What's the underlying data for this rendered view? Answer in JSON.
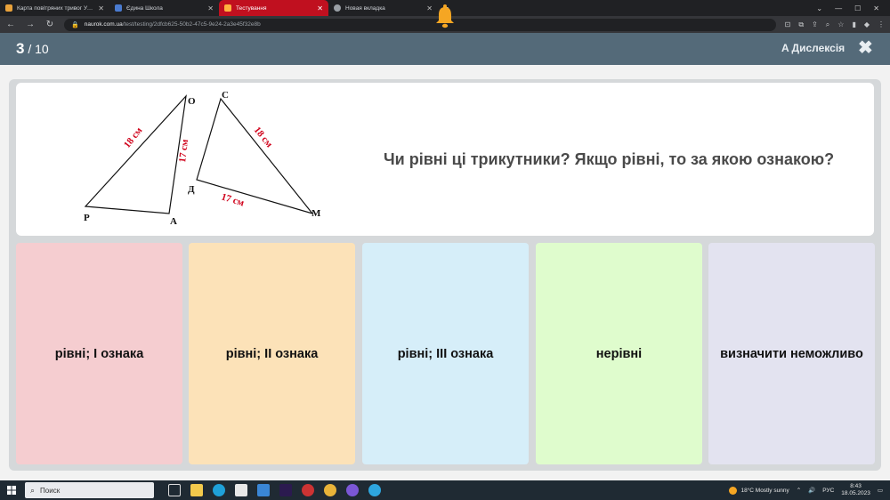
{
  "browser": {
    "tabs": [
      {
        "label": "Карта повітряних тривог України",
        "icon_color": "#e9a23b",
        "active": false
      },
      {
        "label": "Єдина Школа",
        "icon_color": "#4a7bd0",
        "active": false
      },
      {
        "label": "Тестування",
        "icon_color": "#ffb23f",
        "active": true
      },
      {
        "label": "Новая вкладка",
        "icon_color": "#9aa0a6",
        "active": false
      }
    ],
    "new_tab": "+",
    "url_host": "naurok.com.ua",
    "url_path": "/test/testing/2dfcb625-50b2-47c5-9e24-2a3e45f32e8b"
  },
  "header": {
    "current": "3",
    "separator": " / ",
    "total": "10",
    "dyslexia_label": "A Дислексія",
    "close_glyph": "✖",
    "colors": {
      "bar": "#546a79",
      "bell": "#f5a623"
    }
  },
  "question": {
    "text": "Чи рівні ці трикутники? Якщо рівні, то за якою ознакою?",
    "figure": {
      "labels": {
        "O": "O",
        "P": "P",
        "A": "A",
        "C": "C",
        "D": "Д",
        "M": "M"
      },
      "measures": {
        "po": "18 см",
        "oa": "17 см",
        "cm": "18 см",
        "dm": "17 см"
      }
    }
  },
  "answers": [
    {
      "label": "рівні; I ознака",
      "color": "#f5cdd0"
    },
    {
      "label": "рівні; II ознака",
      "color": "#fce2b8"
    },
    {
      "label": "рівні; III ознака",
      "color": "#d6eef9"
    },
    {
      "label": "нерівні",
      "color": "#dffccd"
    },
    {
      "label": "визначити неможливо",
      "color": "#e3e3f0"
    }
  ],
  "taskbar": {
    "search_placeholder": "Поиск",
    "weather": "18°C  Mostly sunny",
    "lang": "РУС",
    "time": "8:43",
    "date": "18.05.2023"
  }
}
